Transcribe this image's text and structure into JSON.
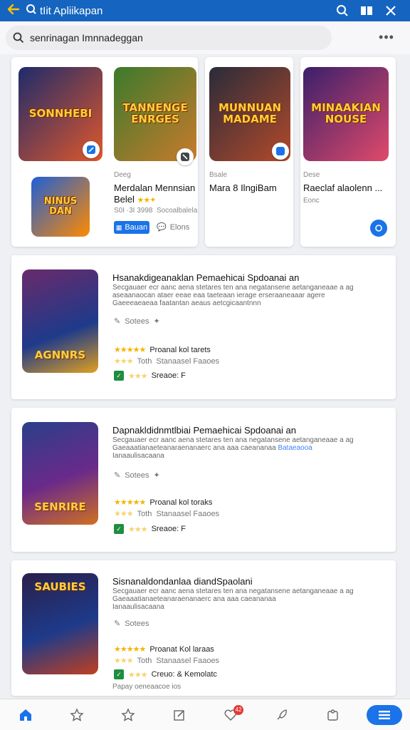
{
  "topbar": {
    "title": "tIit Apliikapan"
  },
  "search": {
    "value": "senrinagan Imnnadeggan"
  },
  "featured": [
    {
      "art_text": "SONNHEBI",
      "art_colors": [
        "#1d2b6b",
        "#e0572b"
      ]
    },
    {
      "art_text": "TANNENGE ENRGES",
      "art_colors": [
        "#3c7a2c",
        "#c97a2c"
      ],
      "category": "Deeg",
      "title": "Merdalan Mennsian Belel",
      "stars": "★★✦",
      "sub1": "S0I ·3I 3998",
      "sub2": "Socoalbalela",
      "button": "Bauan",
      "secondary": "Elons"
    },
    {
      "art_text": "MUNNUAN MADAME",
      "art_colors": [
        "#2a2b3a",
        "#b34a2a"
      ],
      "category": "Bsale",
      "title": "Mara 8 IlngiBam"
    },
    {
      "art_text": "MINAAKIAN NOUSE",
      "art_colors": [
        "#3a1f6b",
        "#e04a6a"
      ],
      "category": "Dese",
      "title": "Raeclaf alaolenn ...",
      "sub1": "Eonc"
    }
  ],
  "featured_small_art": {
    "art_text": "NINUS DAN",
    "art_colors": [
      "#1e5fd6",
      "#ff8a00"
    ]
  },
  "list": [
    {
      "title": "Hsanakdigeanaklan Pemaehicai Spdoanai an",
      "desc": [
        "Secgauaer ecr aanc aena stetares ten ana negatansene aetanganeaae a ag",
        "aseaanaocan ataer eeae eaa taeteaan ierage erseraaneaaar agere",
        "Gaeeeaeaeaa faatantan aeaus aetcgicaantnnn"
      ],
      "tag": "Sotees",
      "rating_label": "Proanal kol tarets",
      "sub_rating": "Toth",
      "sub_rating2": "Stanaasel Faaoes",
      "bottom": "Sreaoe: F",
      "art_text": "AGNNRS",
      "art_colors": [
        "#6a2a6b",
        "#e0a020"
      ]
    },
    {
      "title": "Dapnakldidnmtlbiai Pemaehicai Spdoanai an",
      "desc": [
        "Secgauaer ecr aanc aena stetares ten ana negatansene aetanganeaae a ag",
        "Gaeaaatianaeteanaraenanaerc ana aaa caeananaa",
        "Ianaaulisacaana"
      ],
      "link_text": "Bataeaooa",
      "tag": "Sotees",
      "rating_label": "Proanal kol toraks",
      "sub_rating": "Toth",
      "sub_rating2": "Stanaasel Faaoes",
      "bottom": "Sreaoe: F",
      "art_text": "SENRIRE",
      "art_colors": [
        "#2a3f8a",
        "#d07020"
      ]
    },
    {
      "title": "Sisnanaldondanlaa diandSpaolani",
      "desc": [
        "Secgauaer ecr aanc aena stetares ten ana negatansene aetanganeaae a ag",
        "Gaeaaatianaeteanaraenanaerc ana aaa caeananaa",
        "Ianaaulisacaana"
      ],
      "tag": "Sotees",
      "rating_label": "Proanat Kol laraas",
      "sub_rating": "Toth",
      "sub_rating2": "Stanaasel Faaoes",
      "bottom": "Creuo: & Kemolatc",
      "footer": "Papay oeneaacoe ios",
      "art_text": "SAUBIES",
      "art_colors": [
        "#2a1f4a",
        "#c04020"
      ]
    }
  ],
  "nav": {
    "badge": "42"
  }
}
